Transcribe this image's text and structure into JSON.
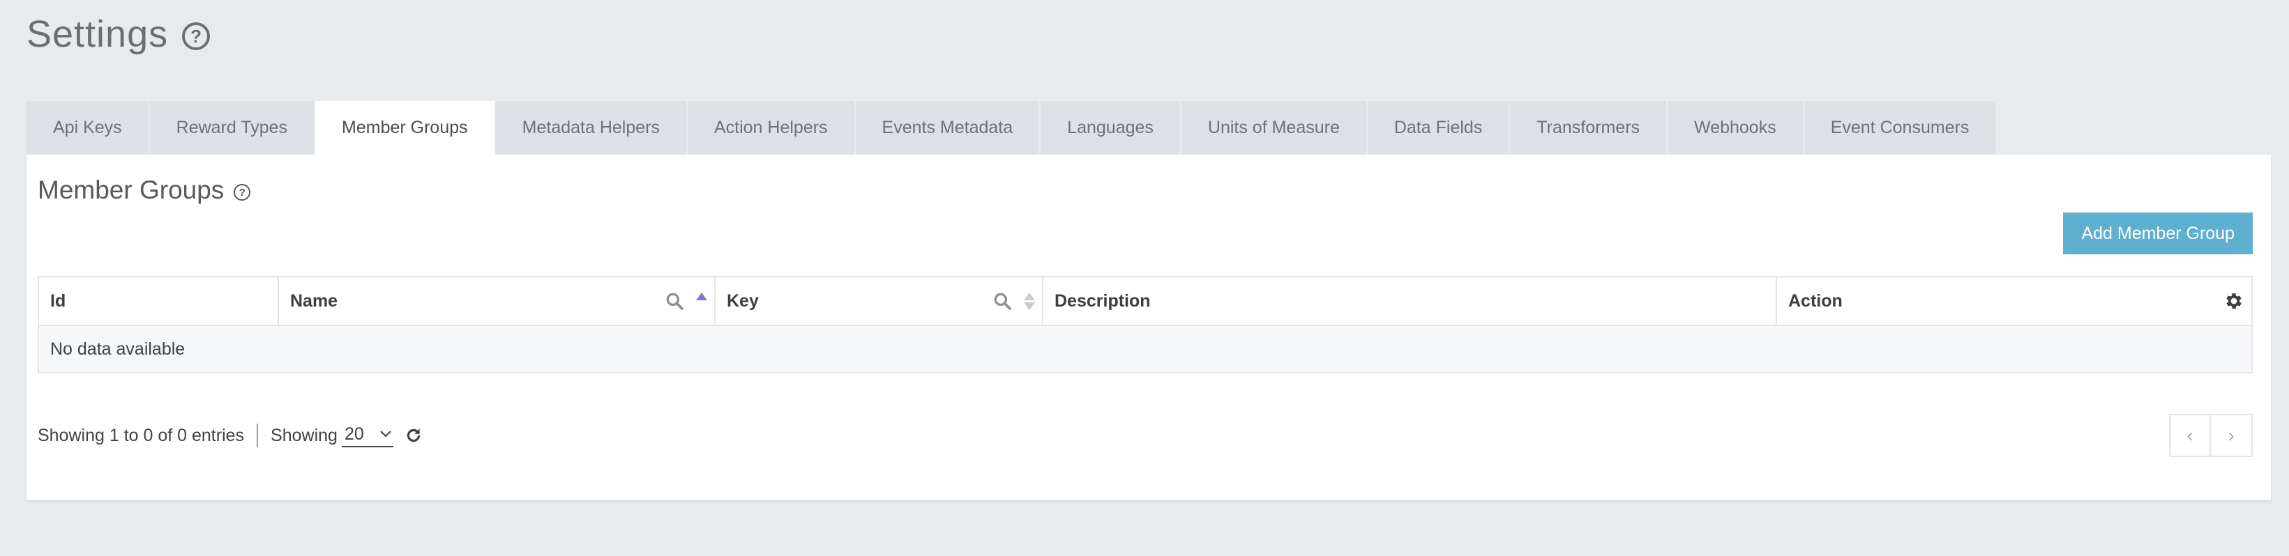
{
  "page": {
    "title": "Settings"
  },
  "tabs": [
    {
      "label": "Api Keys"
    },
    {
      "label": "Reward Types"
    },
    {
      "label": "Member Groups",
      "active": true
    },
    {
      "label": "Metadata Helpers"
    },
    {
      "label": "Action Helpers"
    },
    {
      "label": "Events Metadata"
    },
    {
      "label": "Languages"
    },
    {
      "label": "Units of Measure"
    },
    {
      "label": "Data Fields"
    },
    {
      "label": "Transformers"
    },
    {
      "label": "Webhooks"
    },
    {
      "label": "Event Consumers"
    }
  ],
  "section": {
    "title": "Member Groups",
    "add_button": "Add Member Group"
  },
  "table": {
    "columns": [
      {
        "label": "Id"
      },
      {
        "label": "Name"
      },
      {
        "label": "Key"
      },
      {
        "label": "Description"
      },
      {
        "label": "Action"
      }
    ],
    "empty_text": "No data available"
  },
  "footer": {
    "entries_text": "Showing 1 to 0 of 0 entries",
    "page_size_label": "Showing",
    "page_size_value": "20",
    "prev": "‹",
    "next": "›"
  },
  "colors": {
    "accent": "#5fb0cf",
    "sort_active": "#7b78d8",
    "background": "#e8ebee"
  },
  "icons": {
    "help": "question-circle-icon",
    "search": "search-icon",
    "sort": "sort-icon",
    "settings": "gear-icon",
    "refresh": "refresh-icon"
  }
}
